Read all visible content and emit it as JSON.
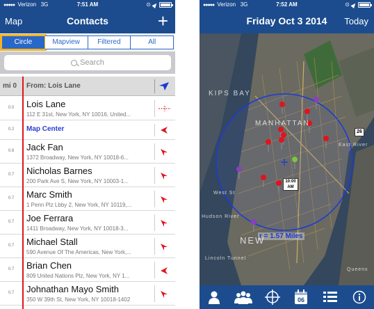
{
  "left_screen": {
    "status": {
      "carrier": "Verizon",
      "network": "3G",
      "time": "7:51 AM"
    },
    "nav": {
      "back_label": "Map",
      "title": "Contacts",
      "add_label": "+"
    },
    "segments": [
      {
        "label": "Circle",
        "selected": true
      },
      {
        "label": "Mapview",
        "selected": false
      },
      {
        "label": "Filtered",
        "selected": false
      },
      {
        "label": "All",
        "selected": false
      }
    ],
    "search": {
      "placeholder": "Search"
    },
    "column_header": {
      "distance_label": "mi 0",
      "from_label": "From: Lois Lane"
    },
    "rows": [
      {
        "distance": "0.0",
        "name": "Lois Lane",
        "address": "112 E 31st, New York, NY 10016, United...",
        "indicator": "crosshair-icon"
      },
      {
        "distance": "0.2",
        "special": "Map Center",
        "indicator": "pointer"
      },
      {
        "distance": "0.6",
        "name": "Jack Fan",
        "address": "1372 Broadway, New York, NY 10018-6...",
        "indicator": "pointer"
      },
      {
        "distance": "0.7",
        "name": "Nicholas Barnes",
        "address": "200 Park Ave S, New York, NY 10003-1...",
        "indicator": "pointer"
      },
      {
        "distance": "0.7",
        "name": "Marc Smith",
        "address": "1 Penn Plz Lbby 2, New York, NY 10119,...",
        "indicator": "pointer"
      },
      {
        "distance": "0.7",
        "name": "Joe Ferrara",
        "address": "1411 Broadway, New York, NY 10018-3...",
        "indicator": "pointer"
      },
      {
        "distance": "0.7",
        "name": "Michael Stall",
        "address": "590 Avenue Of The Americas, New York,...",
        "indicator": "pointer"
      },
      {
        "distance": "0.7",
        "name": "Brian Chen",
        "address": "809 United Nations Plz, New York, NY 1...",
        "indicator": "pointer"
      },
      {
        "distance": "0.7",
        "name": "Johnathan Mayo Smith",
        "address": "350 W 39th St, New York, NY 10018-1402",
        "indicator": "pointer"
      }
    ],
    "colors": {
      "nav": "#1c4c8e",
      "accent": "#2a68c8",
      "selected_outline": "#f5b323",
      "red_line": "#e0141e"
    }
  },
  "right_screen": {
    "status": {
      "carrier": "Verizon",
      "network": "3G",
      "time": "7:52 AM"
    },
    "nav": {
      "title": "Friday Oct 3 2014",
      "right_label": "Today"
    },
    "map": {
      "labels": {
        "kips_bay": "KIPS BAY",
        "manhattan": "MANHATTAN",
        "new": "NEW",
        "east_river": "East River",
        "hudson": "Hudson River",
        "lincoln": "Lincoln Tunnel",
        "west_street": "West St",
        "queens": "Queens"
      },
      "radius_label": "r = 1.57 Miles",
      "time_tag": "10:00 AM",
      "highway_shield": "26",
      "circle_color": "#1b3bd6",
      "pin_colors": {
        "red": "#e0141e",
        "purple": "#8a3fbf",
        "green": "#7cc63f"
      }
    },
    "tab_bar": {
      "calendar_day": "06",
      "icons": [
        "person-icon",
        "group-icon",
        "crosshair-icon",
        "calendar-icon",
        "list-icon",
        "info-icon"
      ]
    }
  }
}
